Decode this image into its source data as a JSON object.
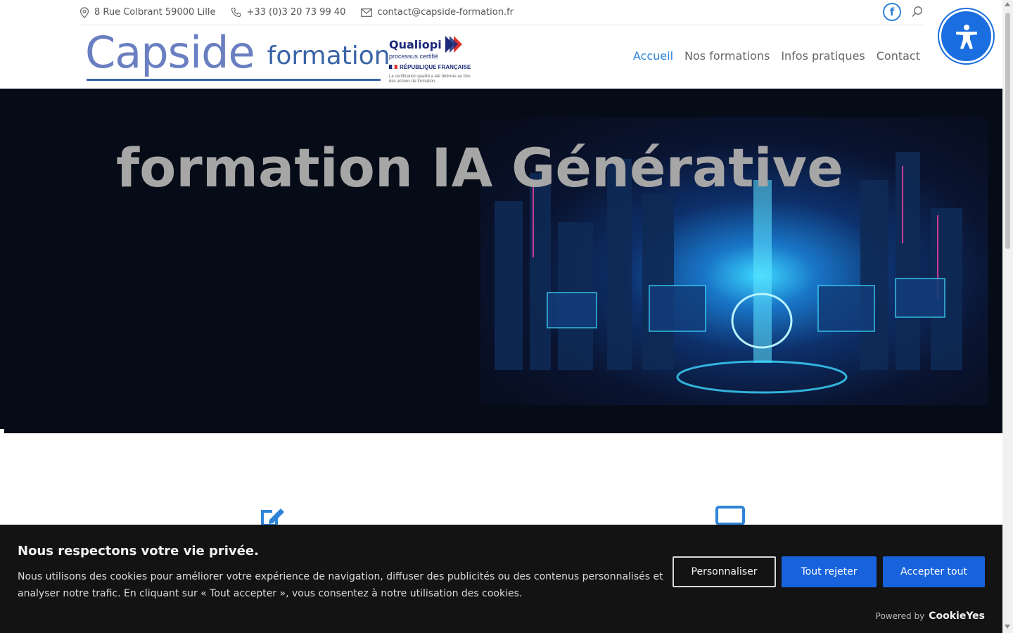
{
  "topbar": {
    "address": "8 Rue Colbrant 59000 Lille",
    "phone": "+33 (0)3 20 73 99 40",
    "email": "contact@capside-formation.fr",
    "facebook_label": "f"
  },
  "logo": {
    "brand": "Capside",
    "sub": "formation",
    "qualiopi_title": "Qualiopi",
    "qualiopi_sub": "processus certifié",
    "qualiopi_republique": "RÉPUBLIQUE FRANÇAISE",
    "qualiopi_note": "La certification qualité a été délivrée au titre des actions de formation."
  },
  "nav": {
    "items": [
      {
        "label": "Accueil",
        "active": true
      },
      {
        "label": "Nos formations",
        "active": false
      },
      {
        "label": "Infos pratiques",
        "active": false
      },
      {
        "label": "Contact",
        "active": false
      }
    ]
  },
  "hero": {
    "title": "formation IA Générative"
  },
  "cookie": {
    "title": "Nous respectons votre vie privée.",
    "text": "Nous utilisons des cookies pour améliorer votre expérience de navigation, diffuser des publicités ou des contenus personnalisés et analyser notre trafic. En cliquant sur « Tout accepter », vous consentez à notre utilisation des cookies.",
    "customize_label": "Personnaliser",
    "reject_label": "Tout rejeter",
    "accept_label": "Accepter tout",
    "powered_by": "Powered by",
    "powered_brand": "CookieYes"
  },
  "colors": {
    "accent": "#2e83d8",
    "cookie_button": "#1863dc",
    "hero_bg": "#050c17"
  }
}
